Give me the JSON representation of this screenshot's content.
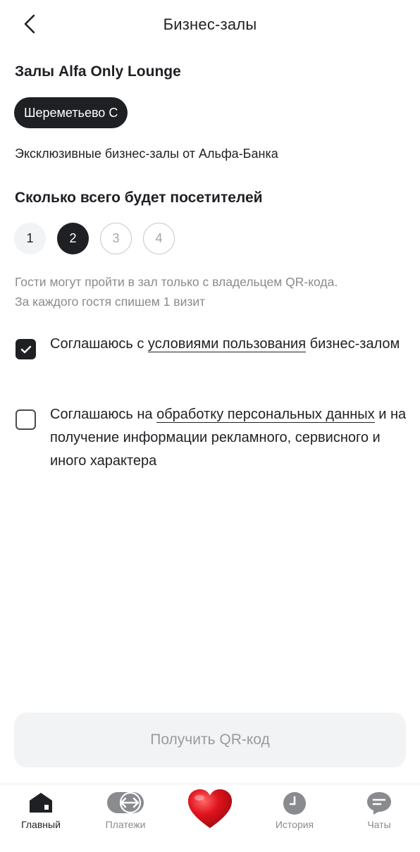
{
  "header": {
    "title": "Бизнес-залы"
  },
  "lounges": {
    "title": "Залы Alfa Only Lounge",
    "selected_chip": "Шереметьево C",
    "description": "Эксклюзивные бизнес-залы от Альфа-Банка"
  },
  "visitors": {
    "title": "Сколько всего будет посетителей",
    "options": [
      "1",
      "2",
      "3",
      "4"
    ],
    "selected": "2",
    "hint_line1": "Гости могут пройти в зал только с владельцем QR-кода.",
    "hint_line2": "За каждого гостя спишем 1 визит"
  },
  "agreements": {
    "terms": {
      "checked": true,
      "prefix": "Соглашаюсь с ",
      "link": "условиями пользования",
      "suffix": " бизнес-залом"
    },
    "personal": {
      "checked": false,
      "prefix": "Соглашаюсь на ",
      "link": "обработку персональных данных",
      "suffix": " и на получение информации рекламного, сервисного и иного характера"
    }
  },
  "action": {
    "qr_button": "Получить QR-код"
  },
  "tabbar": {
    "items": [
      {
        "label": "Главный",
        "icon": "home-icon",
        "active": true
      },
      {
        "label": "Платежи",
        "icon": "transfer-icon",
        "active": false
      },
      {
        "label": "",
        "icon": "heart-icon",
        "active": false
      },
      {
        "label": "История",
        "icon": "clock-icon",
        "active": false
      },
      {
        "label": "Чаты",
        "icon": "chat-icon",
        "active": false
      }
    ]
  },
  "colors": {
    "primary": "#1f2024",
    "muted": "#8a8b8f",
    "surface": "#f2f3f5",
    "heart": "#e0141e"
  }
}
